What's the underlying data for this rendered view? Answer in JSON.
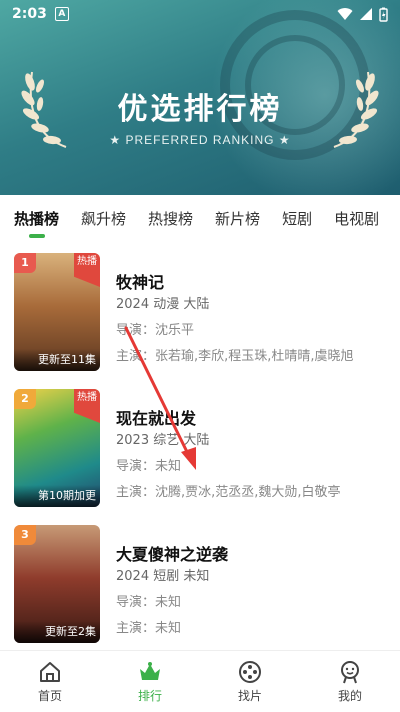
{
  "status_bar": {
    "time": "2:03",
    "notification_icon_label": "A"
  },
  "hero": {
    "title": "优选排行榜",
    "subtitle": "PREFERRED RANKING"
  },
  "tabs": [
    {
      "label": "热播榜",
      "active": true
    },
    {
      "label": "飙升榜"
    },
    {
      "label": "热搜榜"
    },
    {
      "label": "新片榜"
    },
    {
      "label": "短剧"
    },
    {
      "label": "电视剧"
    }
  ],
  "items": [
    {
      "rank": "1",
      "hot_badge": "热播",
      "update": "更新至11集",
      "title": "牧神记",
      "meta": "2024  动漫  大陆",
      "director": "导演：沈乐平",
      "cast": "主演：张若瑜,李欣,程玉珠,杜晴晴,虞晓旭"
    },
    {
      "rank": "2",
      "hot_badge": "热播",
      "update": "第10期加更",
      "title": "现在就出发",
      "meta": "2023  综艺  大陆",
      "director": "导演：未知",
      "cast": "主演：沈腾,贾冰,范丞丞,魏大勋,白敬亭"
    },
    {
      "rank": "3",
      "update": "更新至2集",
      "title": "大夏傻神之逆袭",
      "meta": "2024  短剧  未知",
      "director": "导演：未知",
      "cast": "主演：未知"
    }
  ],
  "bottom_nav": [
    {
      "label": "首页",
      "icon": "home-icon"
    },
    {
      "label": "排行",
      "icon": "ranking-crown-icon",
      "active": true
    },
    {
      "label": "找片",
      "icon": "film-reel-icon"
    },
    {
      "label": "我的",
      "icon": "profile-icon"
    }
  ],
  "colors": {
    "accent": "#3cb04a",
    "hot": "#e0483d",
    "arrow": "#e53935"
  }
}
